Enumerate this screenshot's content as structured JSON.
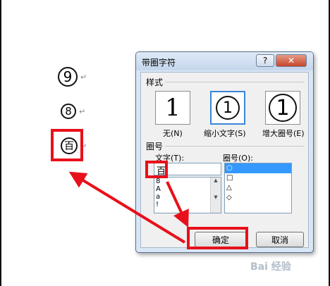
{
  "document": {
    "circled_9": "9",
    "circled_8": "8",
    "circled_bai": "百",
    "para_mark": "↵"
  },
  "dialog": {
    "title": "带圈字符",
    "help": "?",
    "close": "✕",
    "style_section": "样式",
    "styles": [
      {
        "glyph": "1",
        "label": "无(N)"
      },
      {
        "glyph": "1",
        "label": "缩小文字(S)"
      },
      {
        "glyph": "1",
        "label": "增大圈号(E)"
      }
    ],
    "enclosure_section": "圈号",
    "text_label": "文字(T):",
    "text_value": "百",
    "text_list": [
      "8",
      "A",
      "a",
      "!"
    ],
    "enclosure_label": "圈号(O):",
    "enclosure_list": [
      "○",
      "□",
      "△",
      "◇"
    ],
    "ok": "确定",
    "cancel": "取消"
  },
  "colors": {
    "highlight": "#e8101a",
    "selection": "#3399ff"
  },
  "watermark": "Bai 经验"
}
